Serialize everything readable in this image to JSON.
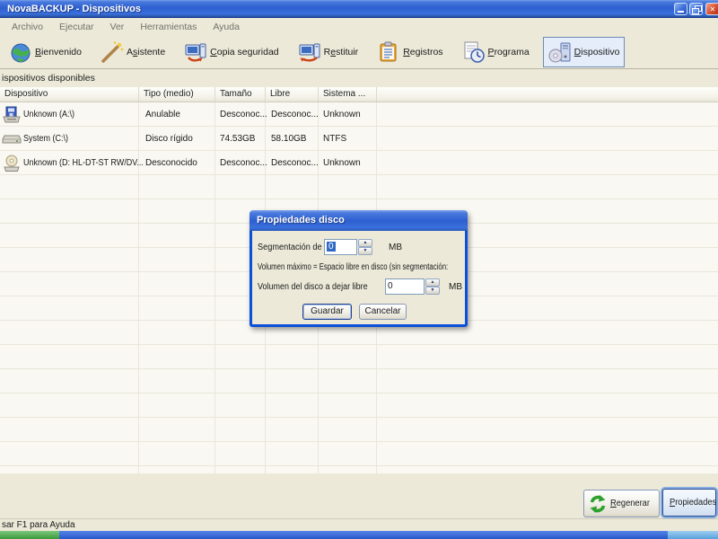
{
  "window": {
    "title": "NovaBACKUP - Dispositivos"
  },
  "menu": {
    "items": [
      "Archivo",
      "Ejecutar",
      "Ver",
      "Herramientas",
      "Ayuda"
    ]
  },
  "toolbar": {
    "items": [
      {
        "label": "Bienvenido",
        "accel": 0,
        "icon": "globe-icon",
        "selected": false
      },
      {
        "label": "Asistente",
        "accel": 1,
        "icon": "magic-wand-icon",
        "selected": false
      },
      {
        "label": "Copia seguridad",
        "accel": 0,
        "icon": "backup-computer-icon",
        "selected": false
      },
      {
        "label": "Restituir",
        "accel": 1,
        "icon": "restore-computer-icon",
        "selected": false
      },
      {
        "label": "Registros",
        "accel": 0,
        "icon": "logs-clipboard-icon",
        "selected": false
      },
      {
        "label": "Programa",
        "accel": 0,
        "icon": "schedule-icon",
        "selected": false
      },
      {
        "label": "Dispositivo",
        "accel": 0,
        "icon": "device-icon",
        "selected": true
      }
    ]
  },
  "section_label": "ispositivos disponibles",
  "table": {
    "columns": [
      "Dispositivo",
      "Tipo (medio)",
      "Tamaño",
      "Libre",
      "Sistema ..."
    ],
    "rows": [
      {
        "icon": "floppy-disk-icon",
        "device": "Unknown (A:\\)",
        "tipo": "Anulable",
        "tamano": "Desconoc...",
        "libre": "Desconoc...",
        "sistema": "Unknown"
      },
      {
        "icon": "hard-disk-icon",
        "device": "System (C:\\)",
        "tipo": "Disco rígido",
        "tamano": "74.53GB",
        "libre": "58.10GB",
        "sistema": "NTFS"
      },
      {
        "icon": "cd-drive-icon",
        "device": "Unknown (D: HL-DT-ST RW/DV...",
        "tipo": "Desconocido",
        "tamano": "Desconoc...",
        "libre": "Desconoc...",
        "sistema": "Unknown"
      }
    ]
  },
  "dialog": {
    "title": "Propiedades disco",
    "segment_label": "Segmentación de",
    "segment_value": "0",
    "segment_unit": "MB",
    "caption": "Volumen máximo = Espacio libre en disco (sin segmentación:",
    "free_label": "Volumen del disco a dejar libre",
    "free_value": "0",
    "free_unit": "MB",
    "save_label": "Guardar",
    "cancel_label": "Cancelar"
  },
  "actions": {
    "regenerate": {
      "label": "Regenerar",
      "accel": 0,
      "icon": "refresh-icon"
    },
    "properties": {
      "label": "Propiedades",
      "accel": 0,
      "icon": "properties-tools-icon"
    }
  },
  "statusbar": {
    "text": "sar F1 para Ayuda"
  },
  "icons": {
    "spin_up": "▲",
    "spin_down": "▼"
  },
  "colors": {
    "titlebar_blue": "#2E5FD0",
    "selection_blue": "#316AC5",
    "window_face": "#ECE9D8",
    "table_bg": "#F9F8F2",
    "taskbar_green": "#3A9A3A",
    "taskbar_blue": "#2858C8",
    "taskbar_tray_blue": "#58A0DC"
  }
}
